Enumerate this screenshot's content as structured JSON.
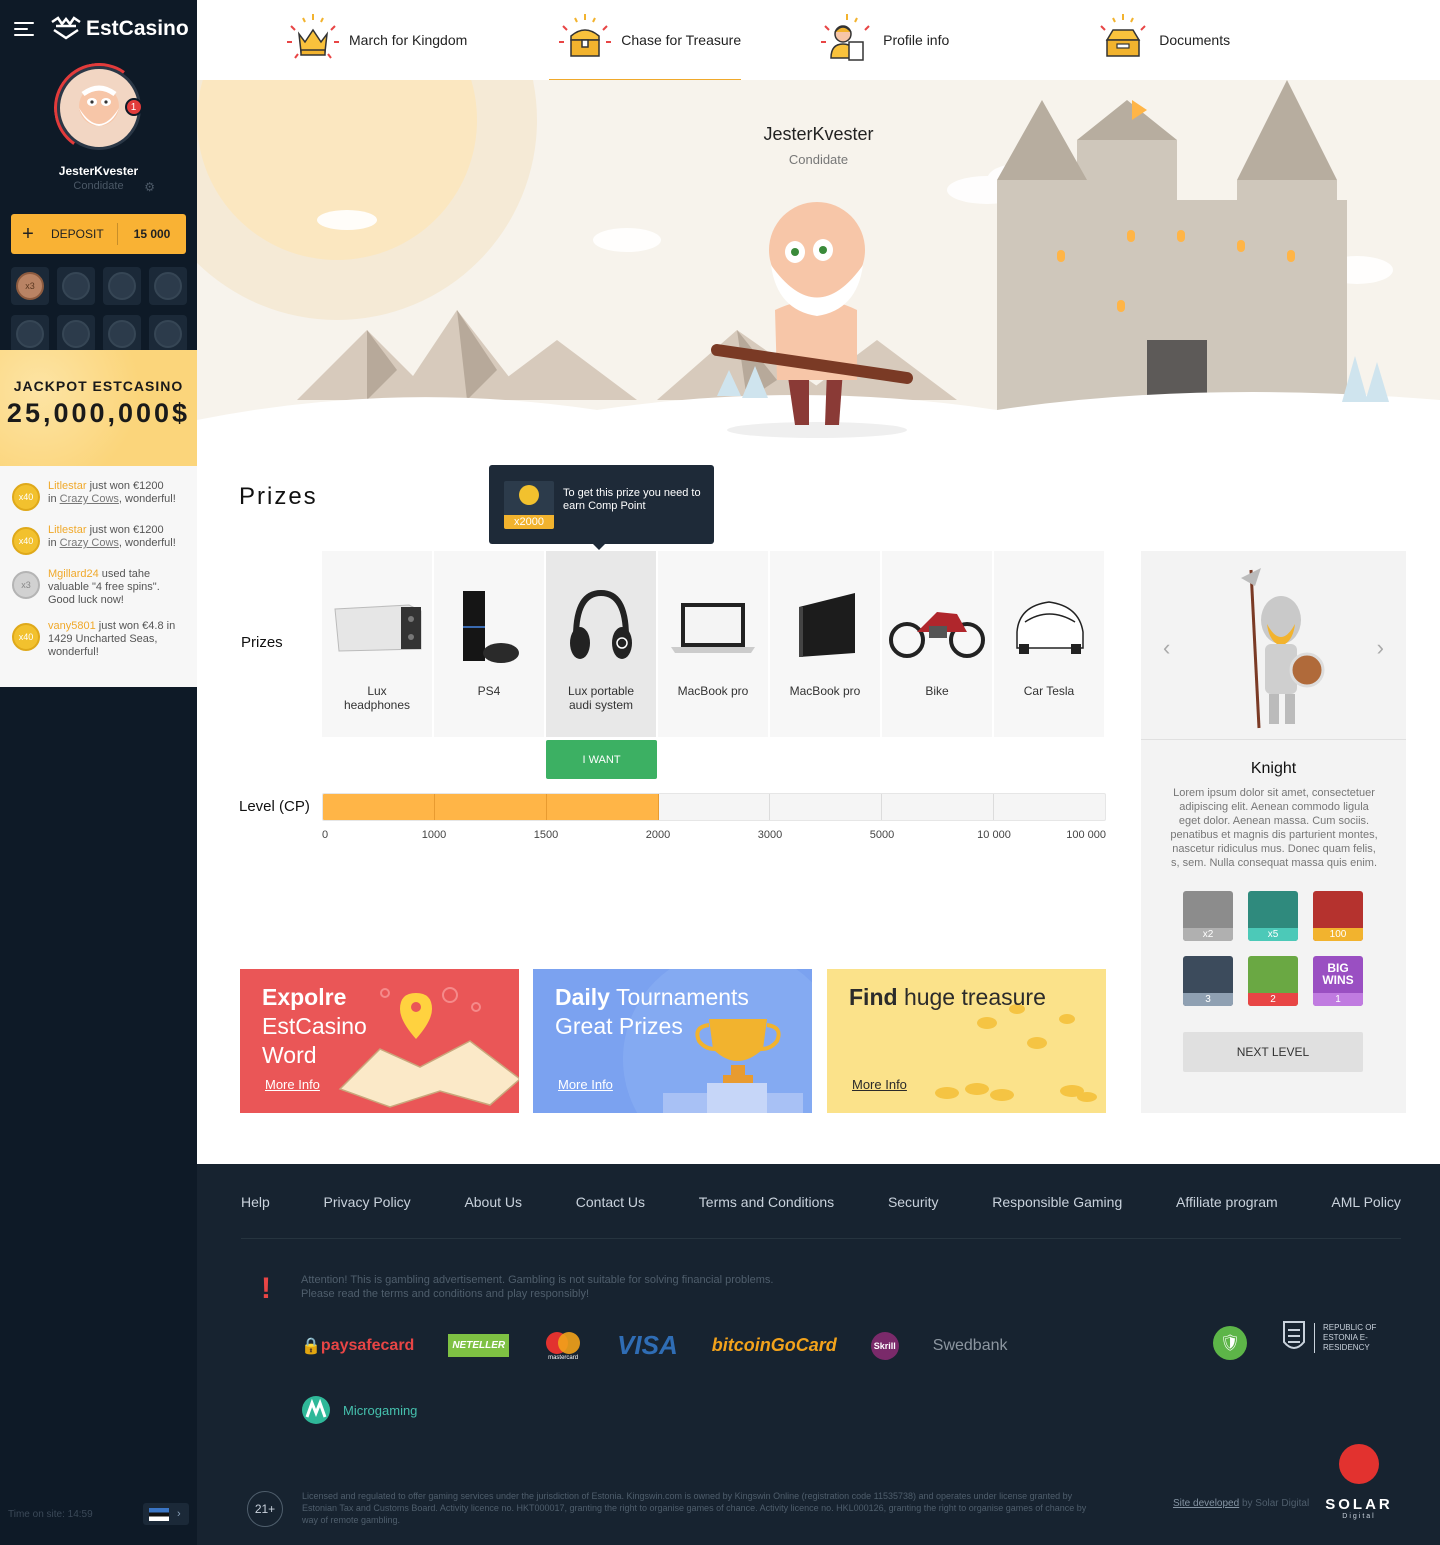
{
  "sidebar": {
    "brand": "EstCasino",
    "username": "JesterKvester",
    "rank": "Condidate",
    "notifications": "1",
    "deposit_label": "DEPOSIT",
    "deposit_amount": "15 000",
    "active_coin": "x3",
    "jackpot_title": "JACKPOT ESTCASINO",
    "jackpot_amount": "25,000,000$",
    "feed": [
      {
        "coin": "x40",
        "user": "Litlestar",
        "text1": " just won €1200",
        "text2": "in ",
        "game": "Crazy Cows",
        "text3": ", wonderful!"
      },
      {
        "coin": "x40",
        "user": "Litlestar",
        "text1": " just won €1200",
        "text2": "in ",
        "game": "Crazy Cows",
        "text3": ", wonderful!"
      },
      {
        "coin": "x3",
        "user": "Mgillard24",
        "text1": " used tahe valuable \"4 free spins\". Good luck now!"
      },
      {
        "coin": "x40",
        "user": "vany5801",
        "text1": " just won €4.8 in 1429 Uncharted Seas, wonderful!"
      }
    ],
    "time_on_site": "Time on site: 14:59"
  },
  "tabs": [
    {
      "label": "March for Kingdom",
      "icon": "crown-icon"
    },
    {
      "label": "Chase for Treasure",
      "icon": "treasure-chest-icon"
    },
    {
      "label": "Profile info",
      "icon": "profile-id-icon"
    },
    {
      "label": "Documents",
      "icon": "document-box-icon"
    }
  ],
  "hero": {
    "name": "JesterKvester",
    "rank": "Condidate"
  },
  "prizes": {
    "section_title": "Prizes",
    "row_label": "Prizes",
    "tooltip_text": "To get this prize you need to earn Comp Point",
    "tooltip_count": "x2000",
    "items": [
      {
        "name": "Lux headphones"
      },
      {
        "name": "PS4"
      },
      {
        "name": "Lux portable audi system"
      },
      {
        "name": "MacBook pro"
      },
      {
        "name": "MacBook pro"
      },
      {
        "name": "Bike"
      },
      {
        "name": "Car Tesla"
      }
    ],
    "iwant_label": "I WANT",
    "level_label": "Level (CP)",
    "level_ticks": [
      "0",
      "1000",
      "1500",
      "2000",
      "3000",
      "5000",
      "10 000",
      "100 000"
    ],
    "level_progress_segments": 3
  },
  "knight": {
    "name": "Knight",
    "description": "Lorem ipsum dolor sit amet, consectetuer adipiscing elit. Aenean commodo ligula eget dolor. Aenean massa. Cum sociis. penatibus et magnis dis parturient montes, nascetur ridiculus mus. Donec quam felis, s, sem. Nulla consequat massa quis enim.",
    "badges": [
      {
        "label": "x2",
        "color": "#8c8c8c",
        "bar": "#b0b0b0"
      },
      {
        "label": "x5",
        "color": "#2f8a7d",
        "bar": "#4cc9b8"
      },
      {
        "label": "100",
        "color": "#b5322e",
        "bar": "#f2b32e"
      },
      {
        "label": "3",
        "color": "#3c4b5c",
        "bar": "#8fa0b2"
      },
      {
        "label": "2",
        "color": "#6aa843",
        "bar": "#e84545"
      },
      {
        "label": "1",
        "color": "#9a4fc2",
        "bar": "#c07be0",
        "top": "BIG WINS"
      }
    ],
    "next_level": "NEXT LEVEL"
  },
  "banners": [
    {
      "bold": "Expolre",
      "rest": "EstCasino Word",
      "more": "More Info"
    },
    {
      "bold": "Daily",
      "rest": "Tournaments Great Prizes",
      "more": "More Info"
    },
    {
      "bold": "Find",
      "rest": "huge treasure",
      "more": "More Info"
    }
  ],
  "footer": {
    "links": [
      "Help",
      "Privacy Policy",
      "About Us",
      "Contact Us",
      "Terms and Conditions",
      "Security",
      "Responsible Gaming",
      "Affiliate program",
      "AML Policy"
    ],
    "warning": "Attention! This is gambling advertisement. Gambling is not suitable for solving financial problems. Please read the terms and conditions and play responsibly!",
    "payments": [
      "paysafecard",
      "NETELLER",
      "mastercard",
      "VISA",
      "bitcoinGoCard",
      "Skrill",
      "Swedbank"
    ],
    "microgaming": "Microgaming",
    "eresidency": "REPUBLIC OF ESTONIA E-RESIDENCY",
    "age": "21+",
    "legal": "Licensed and regulated to offer gaming services under the jurisdiction of Estonia. Kingswin.com is owned by Kingswin Online (registration code 11535738) and operates under license granted by Estonian Tax and Customs Board. Activity licence no. HKT000017, granting the right to organise games of chance. Activity licence no. HKL000126, granting the right to organise games of chance by way of remote gambling.",
    "site_dev_link": "Site developed",
    "site_dev_rest": " by Solar Digital",
    "solar": "SOLAR",
    "solar_sub": "Digital"
  }
}
